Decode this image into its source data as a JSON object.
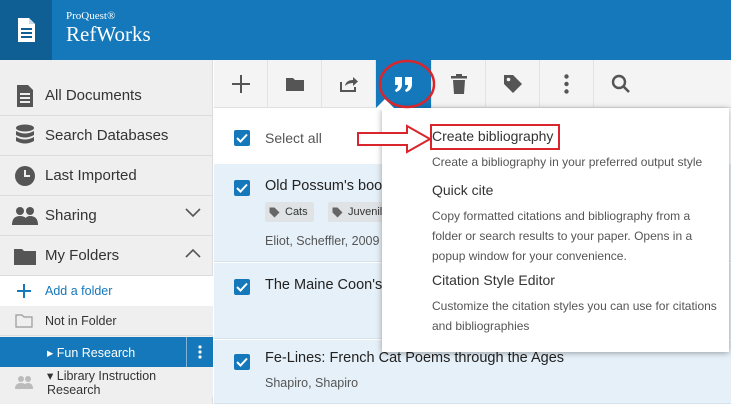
{
  "header": {
    "brand_small": "ProQuest®",
    "brand_big": "RefWorks"
  },
  "sidebar": {
    "items": [
      {
        "label": "All Documents",
        "icon": "document-icon"
      },
      {
        "label": "Search Databases",
        "icon": "database-icon"
      },
      {
        "label": "Last Imported",
        "icon": "clock-icon"
      },
      {
        "label": "Sharing",
        "icon": "users-icon"
      },
      {
        "label": "My Folders",
        "icon": "folder-icon"
      }
    ],
    "add_folder": "Add a folder",
    "not_in_folder": "Not in Folder",
    "fun_research": "▸ Fun Research",
    "library_research": "▾ Library Instruction Research"
  },
  "toolbar": {
    "buttons": [
      "add-icon",
      "folder-icon",
      "share-icon",
      "quote-icon",
      "trash-icon",
      "tag-icon",
      "more-icon",
      "search-icon"
    ],
    "active": "quote-icon"
  },
  "main": {
    "select_all": "Select all",
    "rows": [
      {
        "title": "Old Possum's boo",
        "tags": [
          "Cats",
          "Juvenile"
        ],
        "authors": "Eliot, Scheffler, 2009"
      },
      {
        "title": "The Maine Coon's",
        "tags": [],
        "authors": ""
      },
      {
        "title": "Fe-Lines: French Cat Poems through the Ages",
        "tags": [],
        "authors": "Shapiro, Shapiro"
      }
    ]
  },
  "dropdown": {
    "items": [
      {
        "title": "Create bibliography",
        "desc": "Create a bibliography in your preferred output style"
      },
      {
        "title": "Quick cite",
        "desc": "Copy formatted citations and bibliography from a folder or search results to your paper. Opens in a popup window for your convenience."
      },
      {
        "title": "Citation Style Editor",
        "desc": "Customize the citation styles you can use for citations and bibliographies"
      }
    ]
  },
  "colors": {
    "brand_blue": "#1478ba",
    "annotation_red": "#d9262c"
  }
}
